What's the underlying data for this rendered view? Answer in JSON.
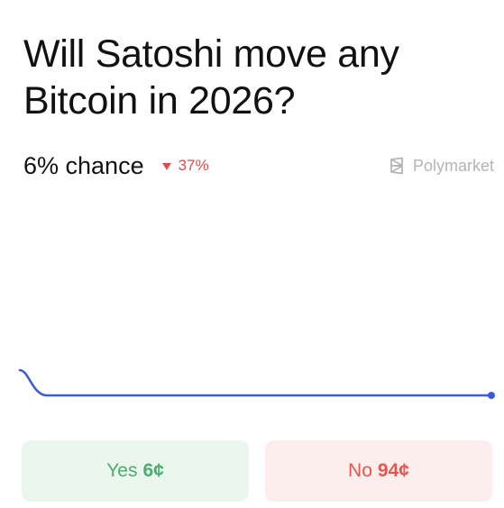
{
  "market": {
    "title": "Will Satoshi move any Bitcoin in 2026?",
    "chance_text": "6% chance",
    "change_text": "37%",
    "change_direction": "down",
    "brand": "Polymarket"
  },
  "chart_data": {
    "type": "line",
    "values": [
      8,
      6,
      6,
      6,
      6
    ],
    "line_color": "#3a5bd9"
  },
  "buttons": {
    "yes_label": "Yes",
    "yes_price": "6¢",
    "no_label": "No",
    "no_price": "94¢"
  },
  "colors": {
    "accent_green": "#4cad6c",
    "accent_red": "#e6564e",
    "line": "#3a5bd9"
  }
}
